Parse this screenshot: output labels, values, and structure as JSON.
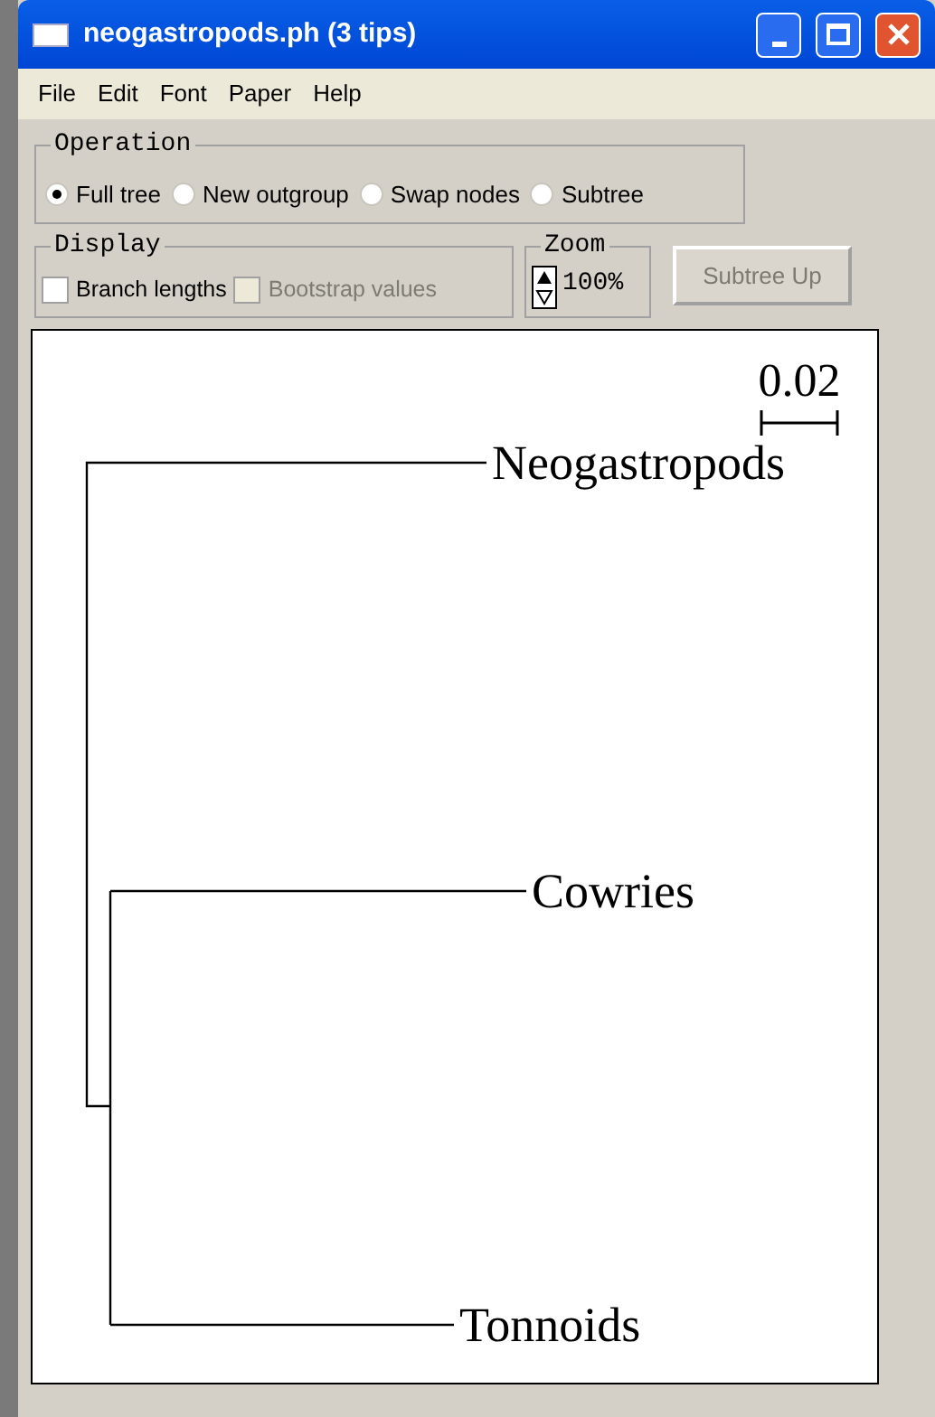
{
  "window": {
    "title": "neogastropods.ph (3 tips)"
  },
  "menu": [
    "File",
    "Edit",
    "Font",
    "Paper",
    "Help"
  ],
  "operation": {
    "label": "Operation",
    "options": [
      {
        "label": "Full tree",
        "selected": true
      },
      {
        "label": "New outgroup",
        "selected": false
      },
      {
        "label": "Swap nodes",
        "selected": false
      },
      {
        "label": "Subtree",
        "selected": false
      }
    ]
  },
  "display": {
    "label": "Display",
    "options": [
      {
        "label": "Branch lengths",
        "checked": false,
        "disabled": false
      },
      {
        "label": "Bootstrap values",
        "checked": false,
        "disabled": true
      }
    ]
  },
  "zoom": {
    "label": "Zoom",
    "value": "100%"
  },
  "subtree_up": {
    "label": "Subtree Up",
    "disabled": true
  },
  "tree": {
    "scale_label": "0.02",
    "tips": [
      "Neogastropods",
      "Cowries",
      "Tonnoids"
    ]
  }
}
